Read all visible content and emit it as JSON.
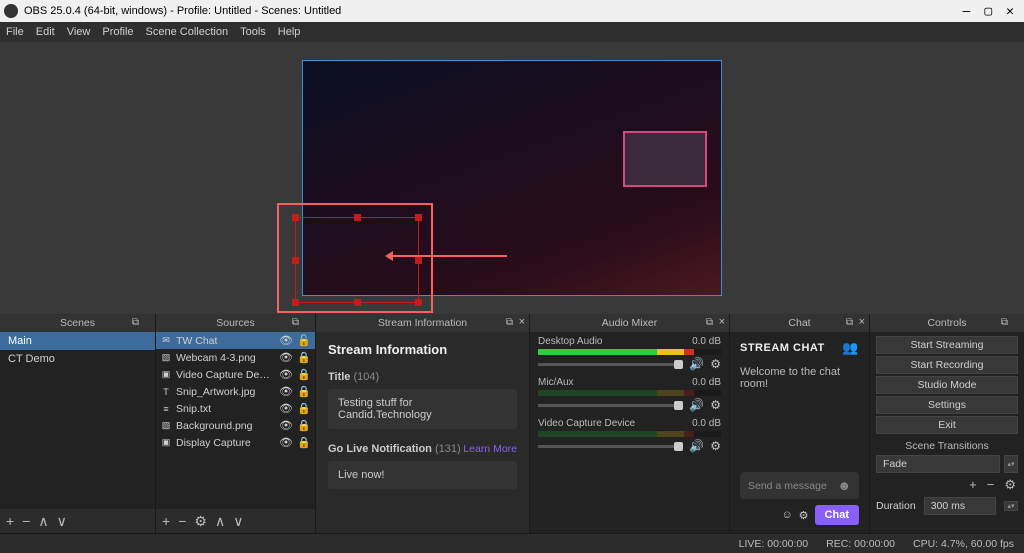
{
  "titlebar": {
    "text": "OBS 25.0.4 (64-bit, windows) - Profile: Untitled - Scenes: Untitled"
  },
  "menu": [
    "File",
    "Edit",
    "View",
    "Profile",
    "Scene Collection",
    "Tools",
    "Help"
  ],
  "panels": {
    "scenes": {
      "title": "Scenes",
      "items": [
        "Main",
        "CT Demo"
      ]
    },
    "sources": {
      "title": "Sources",
      "items": [
        {
          "icon": "✉",
          "label": "TW Chat",
          "locked": false,
          "selected": true
        },
        {
          "icon": "▧",
          "label": "Webcam 4-3.png",
          "locked": true
        },
        {
          "icon": "▣",
          "label": "Video Capture Device",
          "locked": true
        },
        {
          "icon": "T",
          "label": "Snip_Artwork.jpg",
          "locked": true
        },
        {
          "icon": "≡",
          "label": "Snip.txt",
          "locked": true
        },
        {
          "icon": "▧",
          "label": "Background.png",
          "locked": true
        },
        {
          "icon": "▣",
          "label": "Display Capture",
          "locked": true
        }
      ]
    },
    "stream": {
      "title": "Stream Information",
      "heading": "Stream Information",
      "title_label": "Title",
      "title_count": "(104)",
      "title_value": "Testing stuff for Candid.Technology",
      "golive_label": "Go Live Notification",
      "golive_count": "(131)",
      "learn_more": "Learn More",
      "golive_value": "Live now!"
    },
    "audio": {
      "title": "Audio Mixer",
      "channels": [
        {
          "name": "Desktop Audio",
          "db": "0.0 dB",
          "active": true
        },
        {
          "name": "Mic/Aux",
          "db": "0.0 dB",
          "active": false
        },
        {
          "name": "Video Capture Device",
          "db": "0.0 dB",
          "active": false
        }
      ]
    },
    "chat": {
      "title": "Chat",
      "head": "STREAM CHAT",
      "welcome": "Welcome to the chat room!",
      "placeholder": "Send a message",
      "button": "Chat"
    },
    "controls": {
      "title": "Controls",
      "buttons": [
        "Start Streaming",
        "Start Recording",
        "Studio Mode",
        "Settings",
        "Exit"
      ],
      "trans_title": "Scene Transitions",
      "trans_value": "Fade",
      "dur_label": "Duration",
      "dur_value": "300 ms"
    }
  },
  "status": {
    "live": "LIVE: 00:00:00",
    "rec": "REC: 00:00:00",
    "cpu": "CPU: 4.7%, 60.00 fps"
  }
}
